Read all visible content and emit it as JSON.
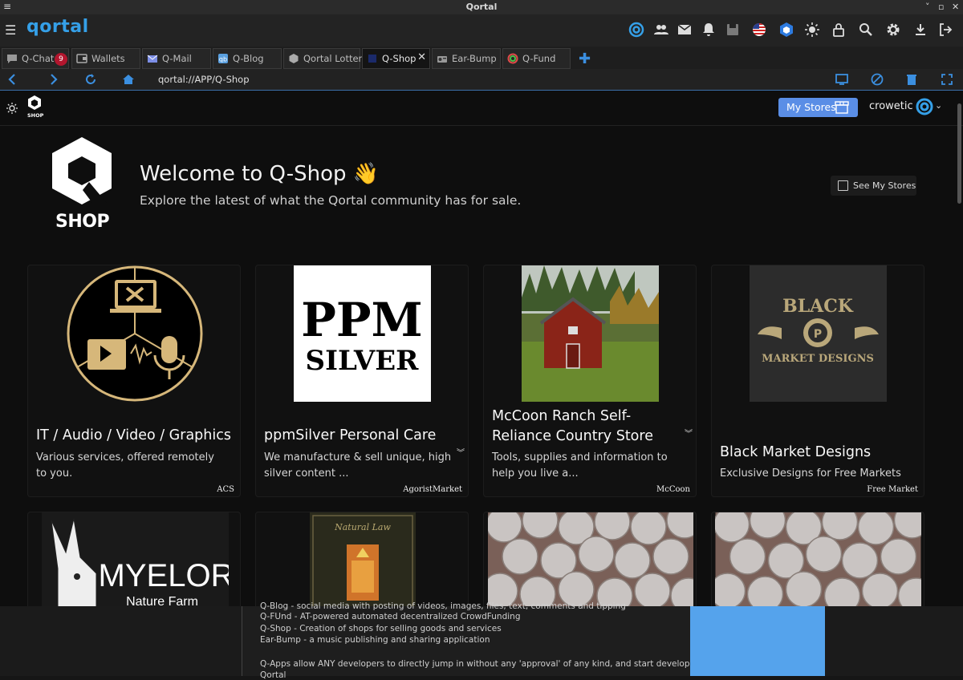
{
  "window": {
    "title": "Qortal",
    "menu_glyph": "≡",
    "controls": [
      "˅",
      "▫",
      "✕"
    ]
  },
  "appbar": {
    "brand": "qortal",
    "icons": [
      "qortal-c-icon",
      "users-icon",
      "mail-icon",
      "bell-icon",
      "save-icon",
      "us-flag-icon",
      "cube-icon",
      "sun-icon",
      "lock-icon",
      "search-icon",
      "gear-icon",
      "download-icon",
      "logout-icon"
    ]
  },
  "tabs": [
    {
      "label": "Q-Chat",
      "badge": "9",
      "icon": "chat-icon"
    },
    {
      "label": "Wallets",
      "icon": "wallet-icon"
    },
    {
      "label": "Q-Mail",
      "icon": "mail-icon"
    },
    {
      "label": "Q-Blog",
      "icon": "blog-icon"
    },
    {
      "label": "Qortal Lottery",
      "icon": "lottery-icon"
    },
    {
      "label": "Q-Shop",
      "icon": "shop-icon",
      "active": true
    },
    {
      "label": "Ear-Bump",
      "icon": "radio-icon"
    },
    {
      "label": "Q-Fund",
      "icon": "fund-icon"
    }
  ],
  "navbar": {
    "url": "qortal://APP/Q-Shop"
  },
  "shop": {
    "my_stores_label": "My Stores",
    "username": "crowetic",
    "logo_text": "SHOP",
    "welcome_title": "Welcome to Q-Shop 👋",
    "welcome_subtitle": "Explore the latest of what the Qortal community has for sale.",
    "see_my_stores": "See My Stores",
    "stores": [
      {
        "title": "IT / Audio / Video / Graphics",
        "desc": "Various services, offered remotely to you.",
        "owner": "ACS"
      },
      {
        "title": "ppmSilver Personal Care",
        "desc": "We manufacture & sell unique, high silver content ...",
        "owner": "AgoristMarket",
        "image_text": [
          "PPM",
          "SILVER"
        ]
      },
      {
        "title": "McCoon Ranch Self-Reliance Country Store",
        "desc": "Tools, supplies and information to help you live a...",
        "owner": "McCoon"
      },
      {
        "title": "Black Market Designs",
        "desc": "Exclusive Designs for Free Markets",
        "owner": "Free Market",
        "image_text": [
          "BLACK",
          "MARKET DESIGNS"
        ]
      },
      {
        "title": "",
        "image_text": [
          "MYELOR",
          "Nature Farm"
        ]
      },
      {
        "title": "",
        "image_text": [
          "Natural Law"
        ]
      },
      {
        "title": ""
      },
      {
        "title": ""
      }
    ]
  },
  "bottom_doc": {
    "lines": [
      "Q-Blog - social media with posting of videos, images, files, text, comments and tipping",
      "Q-FUnd - AT-powered automated decentralized CrowdFunding",
      "Q-Shop - Creation of shops for selling goods and services",
      "Ear-Bump - a music publishing and sharing application",
      "",
      "Q-Apps allow ANY developers to directly jump in without any 'approval' of any kind, and start developing on",
      "Qortal"
    ]
  },
  "colors": {
    "accent": "#35a0e8",
    "my_stores_bg": "#5a8ee6",
    "badge": "#b3162e",
    "background": "#0e0e0e"
  }
}
